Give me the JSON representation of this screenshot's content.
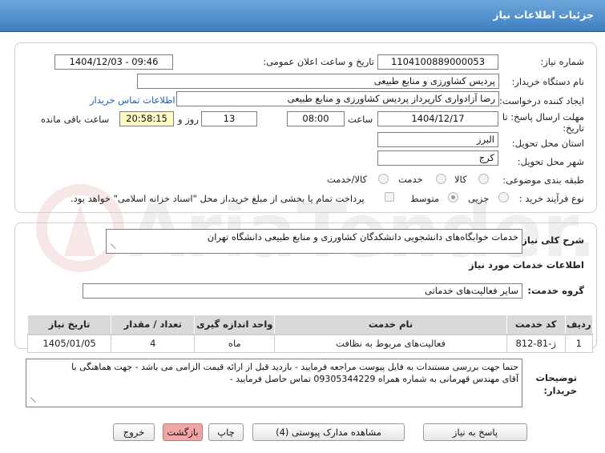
{
  "page": {
    "title": "جزئیات اطلاعات نیاز"
  },
  "form": {
    "need_number": {
      "label": "شماره نیاز:",
      "value": "1104100889000053"
    },
    "announce": {
      "label": "تاریخ و ساعت اعلان عمومی:",
      "value": "1404/12/03 - 09:46"
    },
    "buyer_org": {
      "label": "نام دستگاه خریدار:",
      "value": "پردیس کشاورزی و منابع طبیعی"
    },
    "requester": {
      "label": "ایجاد کننده درخواست:",
      "value": "رضا آزادواری کارپرداز پردیس کشاورزی و منابع طبیعی",
      "contact_link": "اطلاعات تماس خریدار"
    },
    "deadline": {
      "label_line1": "مهلت ارسال پاسخ: تا",
      "label_line2": "تاریخ:",
      "date": "1404/12/17",
      "time_label": "ساعت",
      "time": "08:00",
      "days": "13",
      "days_label": "روز و",
      "remaining": "20:58:15",
      "remaining_label": "ساعت باقی مانده"
    },
    "province": {
      "label": "استان محل تحویل:",
      "value": "البرز"
    },
    "city": {
      "label": "شهر محل تحویل:",
      "value": "کرج"
    },
    "category": {
      "label": "طبقه بندی موضوعی:",
      "options": [
        "کالا",
        "خدمت",
        "کالا/خدمت"
      ],
      "selected": "خدمت"
    },
    "process": {
      "label": "نوع فرآیند خرید :",
      "options": [
        "جزیی",
        "متوسط"
      ],
      "selected": "متوسط",
      "note": "پرداخت تمام یا بخشی از مبلغ خرید،از محل \"اسناد خزانه اسلامی\" خواهد بود."
    }
  },
  "description": {
    "label": "شرح کلی نیاز:",
    "value": "خدمات خوابگاه‌های دانشجویی دانشکدگان کشاورزی و منابع طبیعی دانشگاه تهران"
  },
  "services": {
    "section_title": "اطلاعات خدمات مورد نیاز",
    "group_label": "گروه خدمت:",
    "group_value": "سایر فعالیت‌های خدماتی",
    "columns": [
      "ردیف",
      "کد خدمت",
      "نام خدمت",
      "واحد اندازه گیری",
      "تعداد / مقدار",
      "تاریخ نیاز"
    ],
    "rows": [
      {
        "row": "1",
        "code": "ز-81-812",
        "name": "فعالیت‌های مربوط به نظافت",
        "unit": "ماه",
        "qty": "4",
        "date": "1405/01/05"
      }
    ]
  },
  "buyer_notes": {
    "label_line1": "توضیحات",
    "label_line2": "خریدار:",
    "line1": "حتما جهت بررسی مستندات به فایل پیوست مراجعه فرمایید - بازدید قبل از ارائه قیمت الزامی می باشد - جهت هماهنگی با",
    "line2": "آقای مهندس قهرمانی به شماره همراه 09305344229 تماس حاصل فرمایید  -"
  },
  "buttons": {
    "reply": "پاسخ به نیاز",
    "attachments": "مشاهده مدارک پیوستی (4)",
    "print": "چاپ",
    "back": "بازگشت",
    "exit": "خروج"
  },
  "watermark": {
    "text": "AriaTender.net"
  },
  "colors": {
    "header": "#4a8ccd",
    "yellow": "#fdf9c4",
    "pink": "#f2a5a5",
    "link": "#1a5fb4"
  }
}
